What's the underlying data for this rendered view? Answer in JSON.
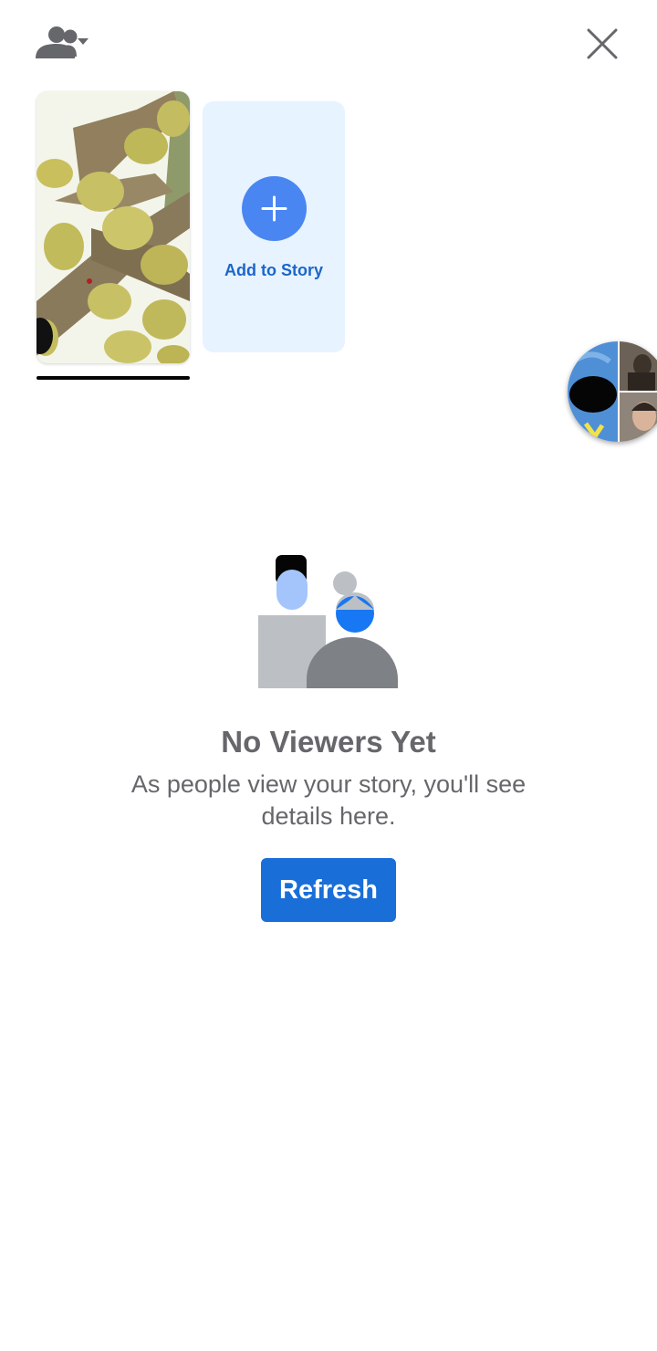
{
  "header": {
    "audience_icon": "people-dropdown-icon",
    "close_icon": "close-icon"
  },
  "stories": {
    "thumbnail_image": "durian-tree-photo",
    "add_story_label": "Add to Story",
    "add_icon": "plus-icon"
  },
  "chat_heads": {
    "icon": "chat-heads-bubble"
  },
  "empty_state": {
    "illustration": "viewers-illustration",
    "title": "No Viewers Yet",
    "subtitle": "As people view your story, you'll see details here.",
    "refresh_label": "Refresh"
  },
  "colors": {
    "primary": "#1a6ed8",
    "add_story_bg": "#e7f3ff",
    "add_story_circle": "#4a86f2",
    "muted_text": "#65676b"
  }
}
